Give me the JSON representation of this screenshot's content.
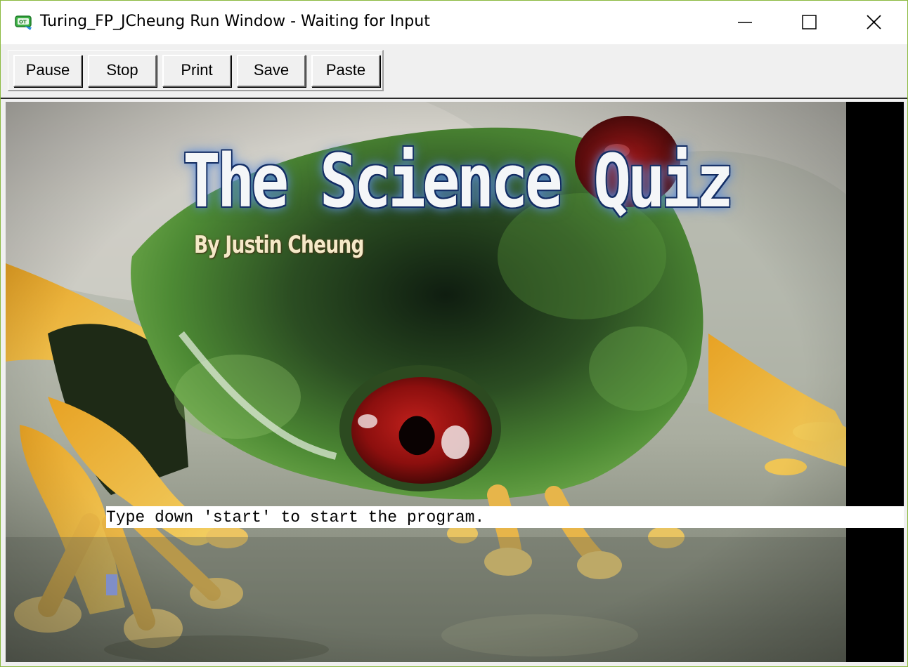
{
  "window": {
    "title": "Turing_FP_JCheung Run Window - Waiting for Input",
    "app_icon": "turing-app-icon",
    "controls": [
      "minimize-icon",
      "maximize-icon",
      "close-icon"
    ]
  },
  "toolbar": {
    "pause_label": "Pause",
    "stop_label": "Stop",
    "print_label": "Print",
    "save_label": "Save",
    "paste_label": "Paste"
  },
  "canvas": {
    "title_graphic": "The Science Quiz",
    "author_graphic": "By Justin Cheung",
    "prompt": "Type down 'start' to start the program.",
    "background_image": "red-eyed tree frog photo"
  },
  "colors": {
    "window_border": "#8ab93e",
    "input_cursor": "#7f8ec8",
    "prompt_background": "#ffffff"
  }
}
